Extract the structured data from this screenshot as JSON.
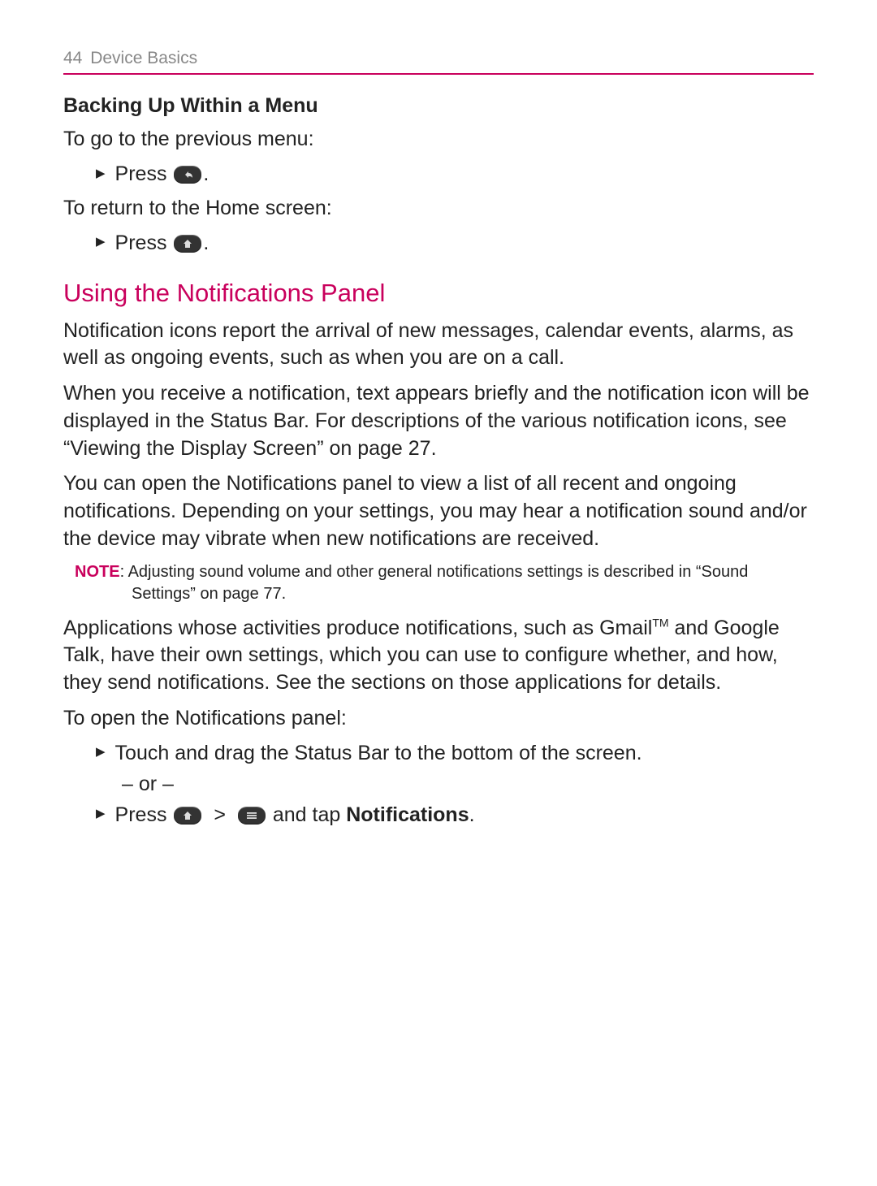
{
  "header": {
    "page_number": "44",
    "chapter": "Device Basics"
  },
  "section1": {
    "title": "Backing Up Within a Menu",
    "intro1": "To go to the previous menu:",
    "bullet1_press": "Press ",
    "bullet1_period": ".",
    "intro2": "To return to the Home screen:",
    "bullet2_press": "Press ",
    "bullet2_period": "."
  },
  "section2": {
    "title": "Using the Notifications Panel",
    "para1": "Notification icons report the arrival of new messages, calendar events, alarms, as well as ongoing events, such as when you are on a call.",
    "para2": "When you receive a notification, text appears briefly and the notification icon will be displayed in the Status Bar. For descriptions of the various notification icons, see “Viewing the Display Screen” on page 27.",
    "para3": "You can open the Notifications panel to view a list of all recent and ongoing notifications. Depending on your settings, you may hear a notification sound and/or the device may vibrate when new notifications are received.",
    "note_label": "NOTE",
    "note_text": ": Adjusting sound volume and other general notifications settings is described in “Sound Settings” on page 77.",
    "para4_a": "Applications whose activities produce notifications, such as Gmail",
    "para4_tm": "TM",
    "para4_b": " and Google Talk, have their own settings, which you can use to configure whether, and how, they send notifications. See the sections on those applications for details.",
    "subhead2": "To open the Notifications panel:",
    "bullet3": "Touch and drag the Status Bar to the bottom of the screen.",
    "or_text": "– or –",
    "bullet4_press": "Press ",
    "bullet4_sep": " > ",
    "bullet4_andtap": " and tap ",
    "bullet4_notifications": "Notifications",
    "bullet4_period": "."
  },
  "icons": {
    "back": "back-key-icon",
    "home": "home-key-icon",
    "menu": "menu-key-icon"
  }
}
